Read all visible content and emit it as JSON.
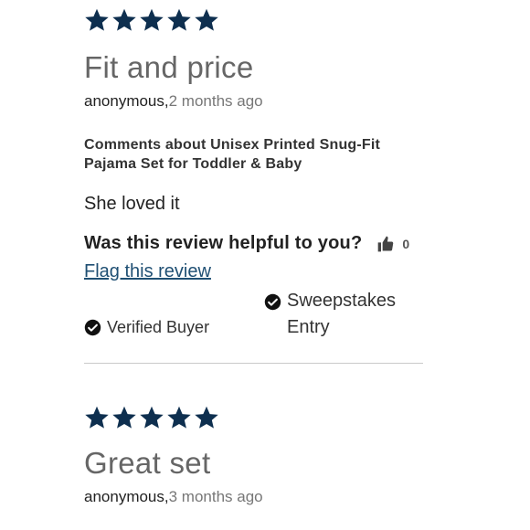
{
  "colors": {
    "star": "#0e2f4f",
    "link": "#1f4f73",
    "muted": "#777777"
  },
  "reviews": [
    {
      "rating": 5,
      "title": "Fit and price",
      "author": "anonymous,",
      "time": "2 months ago",
      "comments_about": "Comments about Unisex Printed Snug-Fit Pajama Set for Toddler & Baby",
      "body": "She loved it",
      "helpful_question": "Was this review helpful to you?",
      "helpful_count": "0",
      "flag_label": "Flag this review",
      "badges": {
        "verified": "Verified Buyer",
        "sweepstakes": "Sweepstakes Entry"
      }
    },
    {
      "rating": 5,
      "title": "Great set",
      "author": "anonymous,",
      "time": "3 months ago"
    }
  ],
  "icons": {
    "star": "star-icon",
    "thumb": "thumbs-up-icon",
    "check": "check-circle-icon"
  }
}
